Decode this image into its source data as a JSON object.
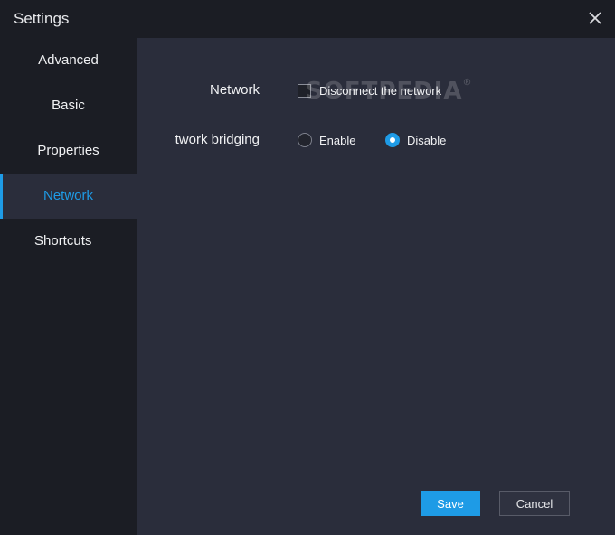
{
  "window": {
    "title": "Settings",
    "close_icon": "close-icon"
  },
  "sidebar": {
    "items": [
      {
        "label": "Advanced",
        "active": false
      },
      {
        "label": "Basic",
        "active": false
      },
      {
        "label": "Properties",
        "active": false
      },
      {
        "label": "Network",
        "active": true
      },
      {
        "label": "Shortcuts",
        "active": false
      }
    ]
  },
  "network": {
    "network_label": "Network",
    "disconnect_label": "Disconnect the network",
    "disconnect_checked": false,
    "bridging_label": "twork bridging",
    "enable_label": "Enable",
    "disable_label": "Disable",
    "bridging_selected": "Disable"
  },
  "watermark": {
    "text": "SOFTPEDIA",
    "mark": "®"
  },
  "footer": {
    "save_label": "Save",
    "cancel_label": "Cancel"
  },
  "colors": {
    "accent": "#1e9be6",
    "window_bg": "#1b1d24",
    "panel_bg": "#2a2d3b"
  }
}
